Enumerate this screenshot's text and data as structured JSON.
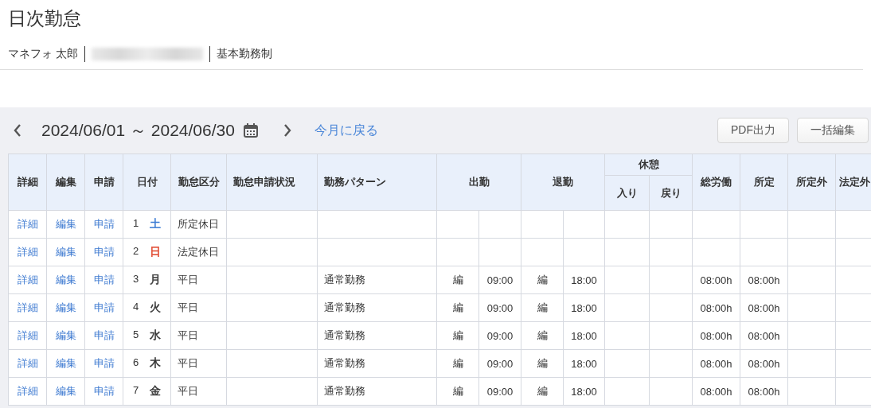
{
  "page_title": "日次勤怠",
  "employee": {
    "name": "マネフォ 太郎",
    "work_system": "基本勤務制"
  },
  "period": {
    "range": "2024/06/01 ～ 2024/06/30",
    "back_link": "今月に戻る"
  },
  "buttons": [
    "PDF出力",
    "一括編集"
  ],
  "table": {
    "columns": [
      {
        "label": "詳細"
      },
      {
        "label": "編集"
      },
      {
        "label": "申請"
      },
      {
        "label": "日付"
      },
      {
        "label": "勤怠区分"
      },
      {
        "label": "勤怠申請状況"
      },
      {
        "label": "勤務パターン"
      },
      {
        "label": "出勤"
      },
      {
        "label": "退勤"
      },
      {
        "label": "休憩",
        "children": [
          "入り",
          "戻り"
        ]
      },
      {
        "label": "総労働"
      },
      {
        "label": "所定"
      },
      {
        "label": "所定外"
      },
      {
        "label": "法定外"
      }
    ],
    "rows": [
      {
        "detail": "詳細",
        "edit": "編集",
        "request": "申請",
        "day": "1",
        "weekday": "土",
        "color": "#3b7bd4",
        "category": "所定休日"
      },
      {
        "detail": "詳細",
        "edit": "編集",
        "request": "申請",
        "day": "2",
        "weekday": "日",
        "color": "#e0482e",
        "category": "法定休日"
      },
      {
        "detail": "詳細",
        "edit": "編集",
        "request": "申請",
        "day": "3",
        "weekday": "月",
        "color": "#333333",
        "category": "平日",
        "pattern": "通常勤務",
        "in_mark": "編",
        "clock_in": "09:00",
        "out_mark": "編",
        "clock_out": "18:00",
        "total": "08:00h",
        "scheduled": "08:00h"
      },
      {
        "detail": "詳細",
        "edit": "編集",
        "request": "申請",
        "day": "4",
        "weekday": "火",
        "color": "#333333",
        "category": "平日",
        "pattern": "通常勤務",
        "in_mark": "編",
        "clock_in": "09:00",
        "out_mark": "編",
        "clock_out": "18:00",
        "total": "08:00h",
        "scheduled": "08:00h"
      },
      {
        "detail": "詳細",
        "edit": "編集",
        "request": "申請",
        "day": "5",
        "weekday": "水",
        "color": "#333333",
        "category": "平日",
        "pattern": "通常勤務",
        "in_mark": "編",
        "clock_in": "09:00",
        "out_mark": "編",
        "clock_out": "18:00",
        "total": "08:00h",
        "scheduled": "08:00h"
      },
      {
        "detail": "詳細",
        "edit": "編集",
        "request": "申請",
        "day": "6",
        "weekday": "木",
        "color": "#333333",
        "category": "平日",
        "pattern": "通常勤務",
        "in_mark": "編",
        "clock_in": "09:00",
        "out_mark": "編",
        "clock_out": "18:00",
        "total": "08:00h",
        "scheduled": "08:00h"
      },
      {
        "detail": "詳細",
        "edit": "編集",
        "request": "申請",
        "day": "7",
        "weekday": "金",
        "color": "#333333",
        "category": "平日",
        "pattern": "通常勤務",
        "in_mark": "編",
        "clock_in": "09:00",
        "out_mark": "編",
        "clock_out": "18:00",
        "total": "08:00h",
        "scheduled": "08:00h"
      }
    ]
  }
}
